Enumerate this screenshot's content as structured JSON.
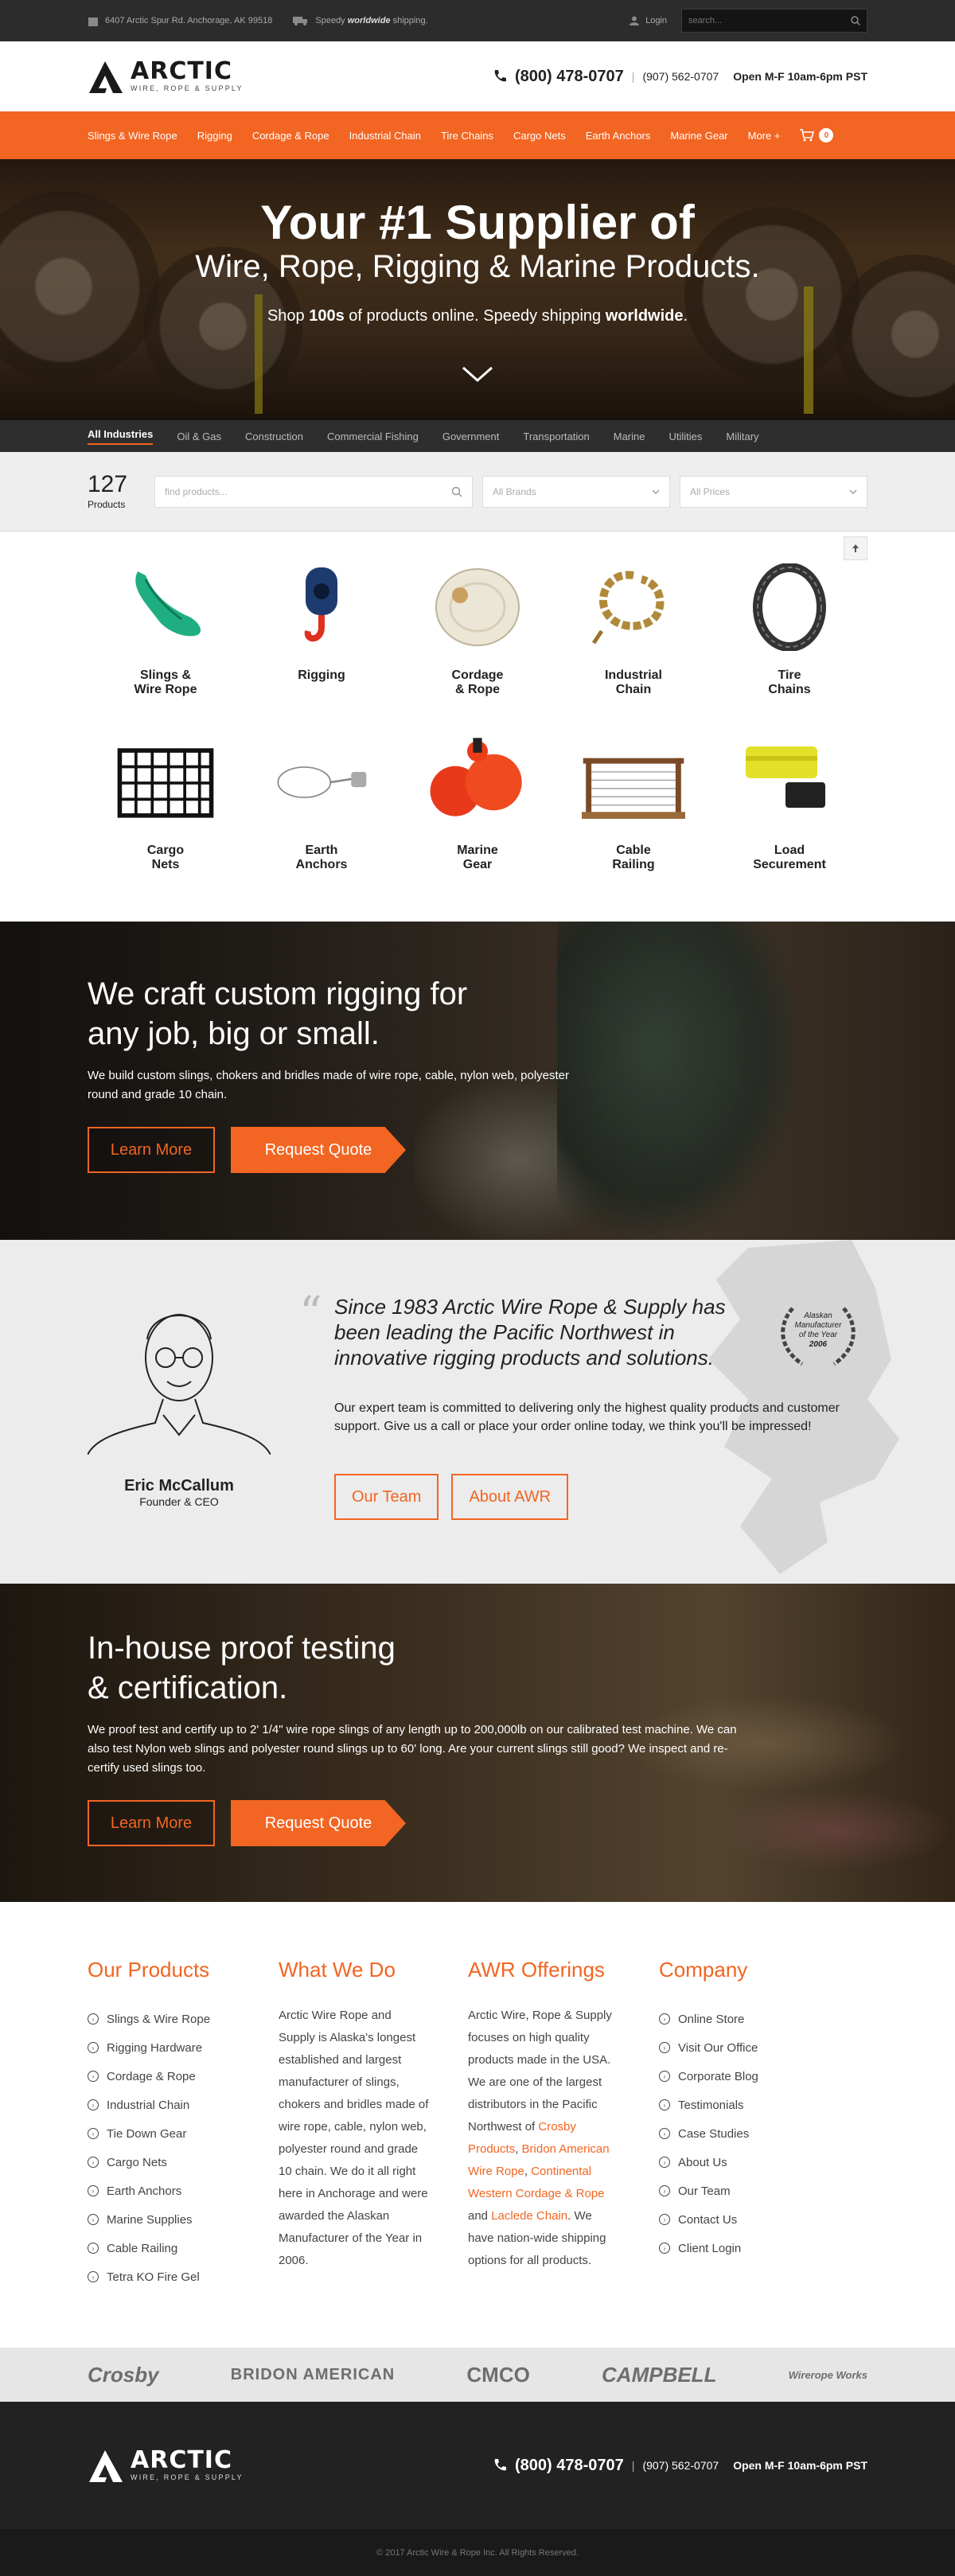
{
  "topbar": {
    "address": "6407 Arctic Spur Rd. Anchorage, AK 99518",
    "shipping_pre": "Speedy ",
    "shipping_bold": "worldwide",
    "shipping_post": " shipping.",
    "login": "Login",
    "search_placeholder": "search..."
  },
  "header": {
    "logo_main": "ARCTIC",
    "logo_sub": "WIRE, ROPE & SUPPLY",
    "phone": "(800) 478-0707",
    "phone_local": "(907) 562-0707",
    "hours": "Open M-F 10am-6pm PST",
    "sep": "|"
  },
  "nav": {
    "items": [
      "Slings & Wire Rope",
      "Rigging",
      "Cordage & Rope",
      "Industrial Chain",
      "Tire Chains",
      "Cargo Nets",
      "Earth Anchors",
      "Marine Gear",
      "More +"
    ],
    "cart_count": "0"
  },
  "hero": {
    "line1": "Your #1 Supplier of",
    "line2": "Wire, Rope, Rigging & Marine Products.",
    "sub_pre": "Shop ",
    "sub_bold1": "100s",
    "sub_mid": " of products online. Speedy shipping ",
    "sub_bold2": "worldwide",
    "sub_post": "."
  },
  "industries": [
    "All Industries",
    "Oil & Gas",
    "Construction",
    "Commercial Fishing",
    "Government",
    "Transportation",
    "Marine",
    "Utilities",
    "Military"
  ],
  "filter": {
    "count": "127",
    "count_label": "Products",
    "find_placeholder": "find products...",
    "brands": "All Brands",
    "prices": "All Prices"
  },
  "categories": [
    {
      "l1": "Slings &",
      "l2": "Wire Rope",
      "icon": "sling"
    },
    {
      "l1": "Rigging",
      "l2": "",
      "icon": "block"
    },
    {
      "l1": "Cordage",
      "l2": "& Rope",
      "icon": "rope"
    },
    {
      "l1": "Industrial",
      "l2": "Chain",
      "icon": "chain"
    },
    {
      "l1": "Tire",
      "l2": "Chains",
      "icon": "tirechain"
    },
    {
      "l1": "Cargo",
      "l2": "Nets",
      "icon": "net"
    },
    {
      "l1": "Earth",
      "l2": "Anchors",
      "icon": "anchor"
    },
    {
      "l1": "Marine",
      "l2": "Gear",
      "icon": "buoy"
    },
    {
      "l1": "Cable",
      "l2": "Railing",
      "icon": "railing"
    },
    {
      "l1": "Load",
      "l2": "Securement",
      "icon": "strap"
    }
  ],
  "craft": {
    "title1": "We craft custom rigging for",
    "title2": "any job, big or small.",
    "body": "We build custom slings, chokers and bridles made of wire rope, cable, nylon web, polyester round and grade 10 chain.",
    "learn": "Learn More",
    "quote": "Request Quote"
  },
  "about": {
    "quote": "Since 1983 Arctic Wire Rope & Supply has been leading the Pacific Northwest in innovative rigging products and solutions.",
    "body": "Our expert team is committed to delivering only the highest quality products and customer support. Give us a call or place your order online today, we think you'll be impressed!",
    "name": "Eric McCallum",
    "role": "Founder & CEO",
    "btn1": "Our Team",
    "btn2": "About AWR",
    "award1": "Alaskan",
    "award2": "Manufacturer",
    "award3": "of the Year",
    "award4": "2006"
  },
  "proof": {
    "title1": "In-house proof testing",
    "title2": "& certification.",
    "body": "We proof test and certify up to 2' 1/4\" wire rope slings of any length up to 200,000lb on our calibrated test machine. We can also test Nylon web slings and polyester round slings up to 60' long. Are your current slings still good? We inspect and re-certify used slings too.",
    "learn": "Learn More",
    "quote": "Request Quote"
  },
  "footer": {
    "products_title": "Our Products",
    "products": [
      "Slings & Wire Rope",
      "Rigging Hardware",
      "Cordage & Rope",
      "Industrial Chain",
      "Tie Down Gear",
      "Cargo Nets",
      "Earth Anchors",
      "Marine Supplies",
      "Cable Railing",
      "Tetra KO Fire Gel"
    ],
    "whatwedo_title": "What We Do",
    "whatwedo": "Arctic Wire Rope and Supply is Alaska's longest established and largest manufacturer of slings, chokers and bridles made of wire rope, cable, nylon web, polyester round and grade 10 chain. We do it all right here in Anchorage and were awarded the Alaskan Manufacturer of the Year in 2006.",
    "offerings_title": "AWR Offerings",
    "off_pre": "Arctic Wire, Rope & Supply focuses on high quality products made in the USA. We are one of the largest distributors in the Pacific Northwest of ",
    "off_l1": "Crosby Products",
    "off_c1": ", ",
    "off_l2": "Bridon American Wire Rope",
    "off_c2": ", ",
    "off_l3": "Continental Western Cordage & Rope",
    "off_and": " and ",
    "off_l4": "Laclede Chain",
    "off_post": ". We have nation-wide shipping options for all products.",
    "company_title": "Company",
    "company": [
      "Online Store",
      "Visit Our Office",
      "Corporate Blog",
      "Testimonials",
      "Case Studies",
      "About Us",
      "Our Team",
      "Contact Us",
      "Client Login"
    ]
  },
  "brands": [
    "Crosby",
    "BRIDON AMERICAN",
    "CMCO",
    "CAMPBELL",
    "Wirerope Works"
  ],
  "copyright": "© 2017 Arctic Wire & Rope Inc. All Rights Reserved.",
  "colors": {
    "accent": "#f26522",
    "dark": "#2c2c2c"
  }
}
